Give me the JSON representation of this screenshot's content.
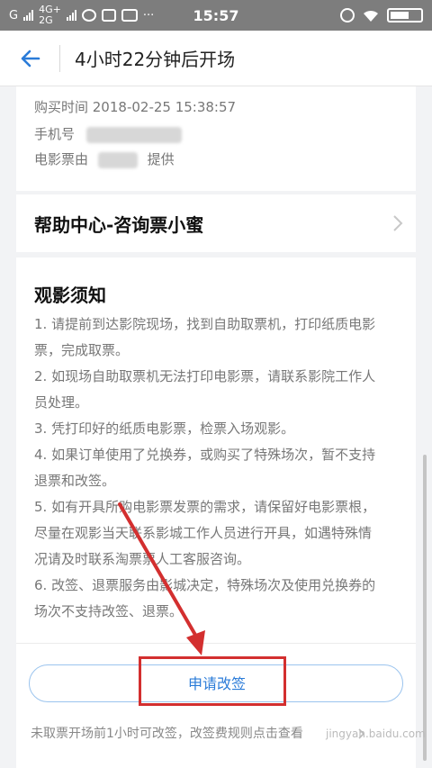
{
  "status_bar": {
    "carrier_g": "G",
    "net_4g": "4G+",
    "net_2g": "2G",
    "time": "15:57",
    "more": "···"
  },
  "header": {
    "title": "4小时22分钟后开场"
  },
  "order_info": {
    "purchase_time": "购买时间 2018-02-25 15:38:57",
    "phone_label": "手机号",
    "ticket_by_prefix": "电影票由",
    "ticket_by_suffix": "提供"
  },
  "help": {
    "title": "帮助中心-咨询票小蜜"
  },
  "notice": {
    "title": "观影须知",
    "lines": [
      "1. 请提前到达影院现场，找到自助取票机，打印纸质电影",
      "票，完成取票。",
      "2. 如现场自助取票机无法打印电影票，请联系影院工作人",
      "员处理。",
      "3. 凭打印好的纸质电影票，检票入场观影。",
      "4. 如果订单使用了兑换券，或购买了特殊场次，暂不支持",
      "退票和改签。",
      "5. 如有开具所购电影票发票的需求，请保留好电影票根，",
      "尽量在观影当天联系影城工作人员进行开具，如遇特殊情",
      "况请及时联系淘票票人工客服咨询。",
      "6. 改签、退票服务由影城决定，特殊场次及使用兑换券的",
      "场次不支持改签、退票。"
    ]
  },
  "action": {
    "button_label": "申请改签",
    "footnote": "未取票开场前1小时可改签，改签费规则点击查看"
  },
  "watermark": "jingyan.baidu.com",
  "colors": {
    "accent": "#2a7bd8",
    "highlight": "#d32f2f",
    "status_bar": "#7d7d7d"
  }
}
